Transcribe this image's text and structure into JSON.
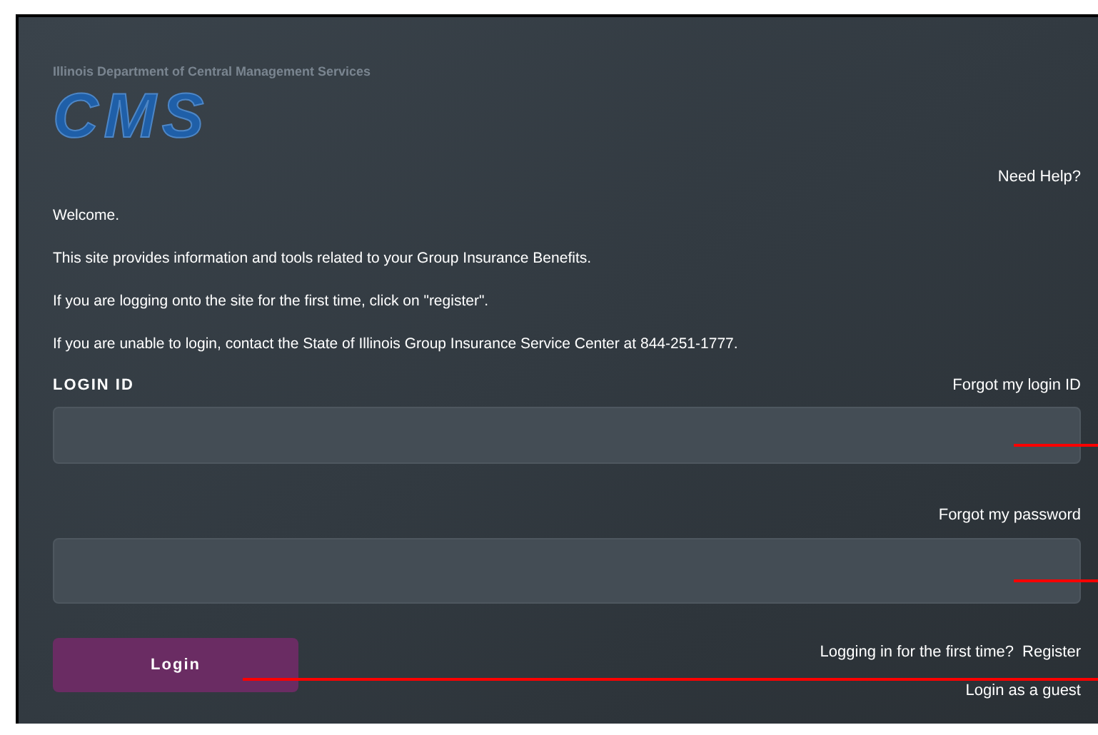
{
  "header": {
    "department": "Illinois Department of Central Management Services",
    "logo": "CMS"
  },
  "help_link": "Need Help?",
  "intro": [
    "Welcome.",
    "This site provides information and tools related to your Group Insurance Benefits.",
    "If you are logging onto the site for the first time, click on \"register\".",
    "If you are unable to login, contact the State of Illinois Group Insurance Service Center at 844-251-1777."
  ],
  "login_id": {
    "label": "LOGIN ID",
    "link": "Forgot my login ID"
  },
  "password": {
    "link": "Forgot my password"
  },
  "login_button": "Login",
  "first_time": {
    "text": "Logging in for the first time?",
    "link": "Register"
  },
  "guest_link": "Login as a guest"
}
